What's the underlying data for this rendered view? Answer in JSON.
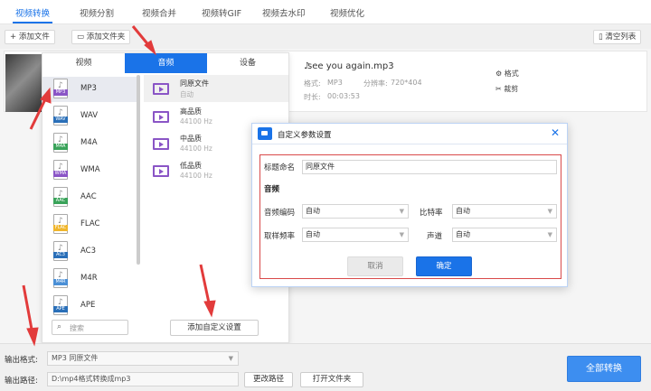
{
  "top_tabs": [
    "视频转换",
    "视频分割",
    "视频合并",
    "视频转GIF",
    "视频去水印",
    "视频优化"
  ],
  "toolbar": {
    "add_file": "添加文件",
    "add_folder": "添加文件夹",
    "clear_list": "清空列表"
  },
  "file": {
    "name": "see you again.mp3",
    "format_label": "格式:",
    "format_value": "MP3",
    "resolution_label": "分辨率:",
    "resolution_value": "720*404",
    "duration_label": "时长:",
    "duration_value": "00:03:53",
    "action_format": "格式",
    "action_crop": "裁剪"
  },
  "format_panel": {
    "tabs": [
      "视频",
      "音频",
      "设备"
    ],
    "formats": [
      "MP3",
      "WAV",
      "M4A",
      "WMA",
      "AAC",
      "FLAC",
      "AC3",
      "M4R",
      "APE"
    ],
    "format_colors": [
      "#8a55c6",
      "#2a6fb8",
      "#3aa35a",
      "#8a55c6",
      "#3aa35a",
      "#f0b62d",
      "#2a6fb8",
      "#4a8fd6",
      "#2a6fb8"
    ],
    "qualities": [
      {
        "name": "同原文件",
        "sub": "自动"
      },
      {
        "name": "高品质",
        "sub": "44100 Hz"
      },
      {
        "name": "中品质",
        "sub": "44100 Hz"
      },
      {
        "name": "低品质",
        "sub": "44100 Hz"
      }
    ],
    "search_placeholder": "搜索",
    "custom_button": "添加自定义设置"
  },
  "dialog": {
    "title": "自定义参数设置",
    "title_label": "标题命名",
    "title_value": "同原文件",
    "section_audio": "音频",
    "audio_codec_label": "音频编码",
    "audio_codec_value": "自动",
    "bitrate_label": "比特率",
    "bitrate_value": "自动",
    "sample_rate_label": "取样频率",
    "sample_rate_value": "自动",
    "channel_label": "声道",
    "channel_value": "自动",
    "cancel": "取消",
    "ok": "确定"
  },
  "bottom": {
    "output_format_label": "输出格式:",
    "output_format_value": "MP3  同原文件",
    "output_path_label": "输出路径:",
    "output_path_value": "D:\\mp4格式转换成mp3",
    "change_path": "更改路径",
    "open_folder": "打开文件夹",
    "convert_all": "全部转换"
  },
  "colors": {
    "accent": "#1a73e8",
    "arrow": "#e23b3b"
  }
}
